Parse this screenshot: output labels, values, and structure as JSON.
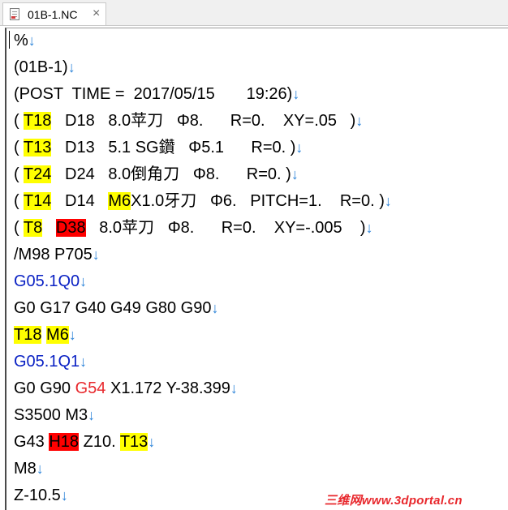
{
  "tab": {
    "title": "01B-1.NC",
    "close": "×"
  },
  "eol": "↓",
  "lines": [
    {
      "segs": [
        {
          "t": "%"
        }
      ]
    },
    {
      "segs": [
        {
          "t": "(01B-1)"
        }
      ]
    },
    {
      "segs": [
        {
          "t": "(POST  TIME =  2017/05/15       19:26)"
        }
      ]
    },
    {
      "segs": [
        {
          "t": "( "
        },
        {
          "t": "T18",
          "hl": "yellow"
        },
        {
          "t": "   D18   8.0苹刀   Φ8.      R=0.    XY=.05   )"
        }
      ]
    },
    {
      "segs": [
        {
          "t": "( "
        },
        {
          "t": "T13",
          "hl": "yellow"
        },
        {
          "t": "   D13   5.1 SG鑽   Φ5.1      R=0. )"
        }
      ]
    },
    {
      "segs": [
        {
          "t": "( "
        },
        {
          "t": "T24",
          "hl": "yellow"
        },
        {
          "t": "   D24   8.0倒角刀   Φ8.      R=0. )"
        }
      ]
    },
    {
      "segs": [
        {
          "t": "( "
        },
        {
          "t": "T14",
          "hl": "yellow"
        },
        {
          "t": "   D14   "
        },
        {
          "t": "M6",
          "hl": "yellow"
        },
        {
          "t": "X1.0牙刀   Φ6.   PITCH=1.    R=0. )"
        }
      ]
    },
    {
      "segs": [
        {
          "t": "( "
        },
        {
          "t": "T8",
          "hl": "yellow"
        },
        {
          "t": "   "
        },
        {
          "t": "D38",
          "hl": "red"
        },
        {
          "t": "   8.0苹刀   Φ8.      R=0.    XY=-.005    )"
        }
      ]
    },
    {
      "segs": [
        {
          "t": "/M98 P705"
        }
      ]
    },
    {
      "segs": [
        {
          "t": "G05.1Q0",
          "color": "blue"
        }
      ]
    },
    {
      "segs": [
        {
          "t": "G0 G17 G40 G49 G80 G90"
        }
      ]
    },
    {
      "segs": [
        {
          "t": "T18",
          "hl": "yellow"
        },
        {
          "t": " "
        },
        {
          "t": "M6",
          "hl": "yellow"
        }
      ]
    },
    {
      "segs": [
        {
          "t": "G05.1Q1",
          "color": "blue"
        }
      ]
    },
    {
      "segs": [
        {
          "t": "G0 G90 "
        },
        {
          "t": "G54",
          "color": "red"
        },
        {
          "t": " X1.172 Y-38.399"
        }
      ]
    },
    {
      "segs": [
        {
          "t": "S3500 M3"
        }
      ]
    },
    {
      "segs": [
        {
          "t": "G43 "
        },
        {
          "t": "H18",
          "hl": "red"
        },
        {
          "t": " Z10. "
        },
        {
          "t": "T13",
          "hl": "yellow"
        }
      ]
    },
    {
      "segs": [
        {
          "t": "M8"
        }
      ]
    },
    {
      "segs": [
        {
          "t": "Z-10.5"
        }
      ]
    }
  ],
  "watermark": "三维网www.3dportal.cn"
}
